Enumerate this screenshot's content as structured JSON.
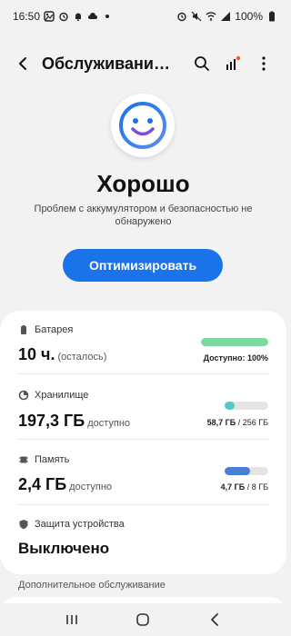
{
  "status_bar": {
    "time": "16:50",
    "battery_percent": "100%"
  },
  "appbar": {
    "title": "Обслуживание устройства"
  },
  "hero": {
    "status": "Хорошо",
    "description": "Проблем с аккумулятором и безопасностью не обнаружено"
  },
  "optimize_button": {
    "label": "Оптимизировать"
  },
  "colors": {
    "accent": "#1a73e8",
    "battery": "#7ed9a0",
    "storage": "#56c7c9",
    "memory": "#4a7fd6"
  },
  "rows": {
    "battery": {
      "label": "Батарея",
      "value": "10 ч.",
      "suffix": "(осталось)",
      "caption": "Доступно: 100%",
      "level": 1.0
    },
    "storage": {
      "label": "Хранилище",
      "value": "197,3 ГБ",
      "suffix": "доступно",
      "caption_used": "58,7 ГБ",
      "caption_total": " / 256 ГБ",
      "level": 0.23
    },
    "memory": {
      "label": "Память",
      "value": "2,4 ГБ",
      "suffix": "доступно",
      "caption_used": "4,7 ГБ",
      "caption_total": " / 8 ГБ",
      "level": 0.59
    },
    "protection": {
      "label": "Защита устройства",
      "value": "Выключено"
    }
  },
  "extra": {
    "label": "Дополнительное обслуживание"
  }
}
